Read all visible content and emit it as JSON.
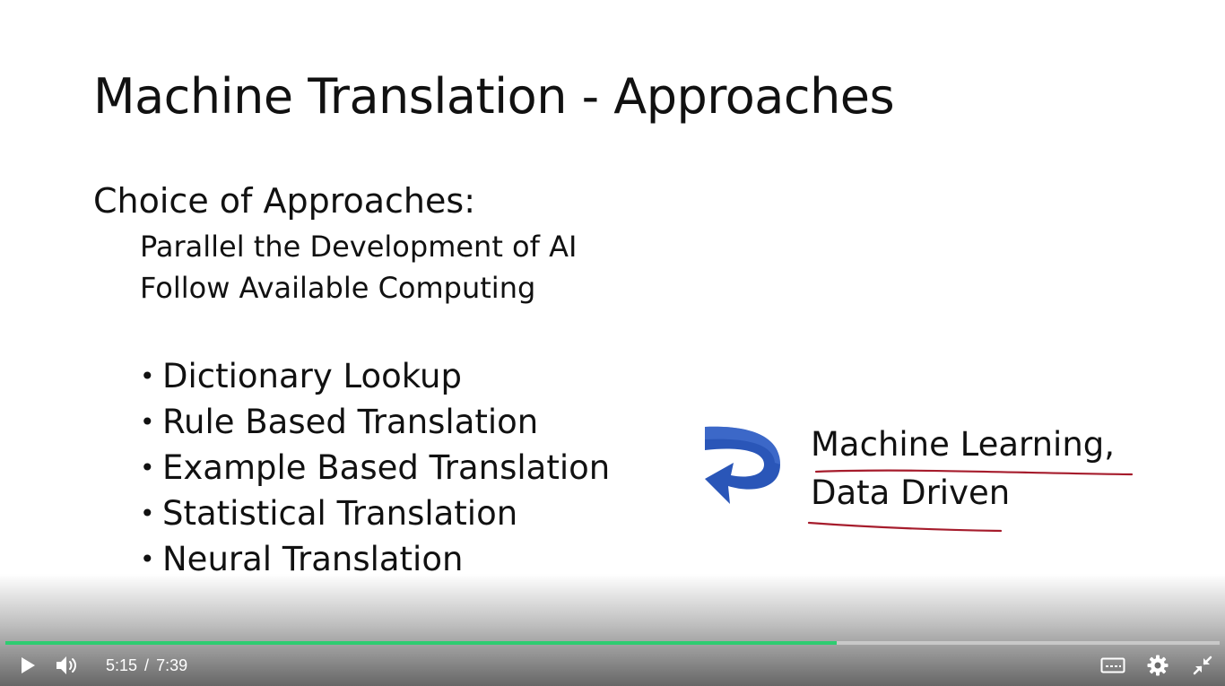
{
  "slide": {
    "title": "Machine Translation - Approaches",
    "heading": "Choice of Approaches:",
    "sub_points": [
      "Parallel the Development of AI",
      "Follow Available Computing"
    ],
    "bullet_symbol": "•",
    "bullets": [
      "Dictionary Lookup",
      "Rule Based Translation",
      "Example Based Translation",
      "Statistical Translation",
      "Neural Translation"
    ],
    "annotation_line1": "Machine Learning,",
    "annotation_line2": "Data Driven",
    "arrow_icon": "curved-arrow-icon",
    "colors": {
      "arrow": "#2a56b8",
      "ink_underline": "#a61c2c"
    }
  },
  "player": {
    "current_time": "5:15",
    "time_separator": "/",
    "duration": "7:39",
    "progress_fraction": 0.685,
    "colors": {
      "progress": "#2ecc71"
    },
    "icons": {
      "play": "play-icon",
      "volume": "volume-icon",
      "captions": "captions-icon",
      "settings": "gear-icon",
      "exit_fullscreen": "exit-fullscreen-icon"
    }
  }
}
